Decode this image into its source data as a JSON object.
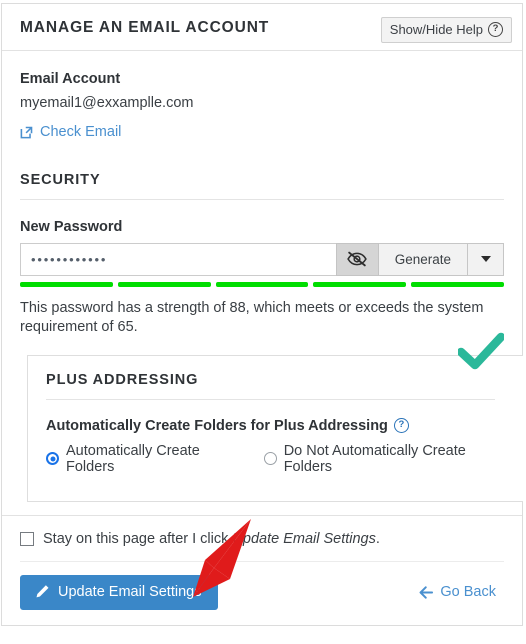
{
  "header": {
    "title": "MANAGE AN EMAIL ACCOUNT",
    "help_button": "Show/Hide Help",
    "help_icon": "question-circle-icon"
  },
  "account": {
    "label": "Email Account",
    "value": "myemail1@exxamplle.com",
    "check_email_link": "Check Email",
    "check_email_icon": "external-link-icon"
  },
  "security": {
    "section_title": "SECURITY",
    "password_label": "New Password",
    "password_value": "••••••••••••",
    "password_placeholder": "",
    "toggle_icon": "eye-slash-icon",
    "generate_label": "Generate",
    "caret_icon": "chevron-down-icon",
    "strength_segments": 5,
    "strength_color": "#00dd00",
    "strength_message": "This password has a strength of 88, which meets or exceeds the system requirement of 65.",
    "strength_value": 88,
    "strength_requirement": 65,
    "valid_icon": "check-mark-icon",
    "valid_icon_color": "#2bb89a"
  },
  "plus_addressing": {
    "section_title": "PLUS ADDRESSING",
    "setting_label": "Automatically Create Folders for Plus Addressing",
    "help_icon": "question-circle-icon",
    "options": [
      {
        "label": "Automatically Create Folders",
        "selected": true
      },
      {
        "label": "Do Not Automatically Create Folders",
        "selected": false
      }
    ]
  },
  "footer": {
    "stay_prefix": "Stay on this page after I click ",
    "stay_emphasis": "Update Email Settings",
    "stay_suffix": ".",
    "stay_checked": false,
    "submit_label": "Update Email Settings",
    "submit_icon": "pencil-icon",
    "submit_color": "#3a87c8",
    "go_back_label": "Go Back",
    "go_back_icon": "arrow-left-icon"
  },
  "annotation": {
    "arrow_color": "#e01b1b",
    "arrow_icon": "red-pointer-arrow"
  }
}
